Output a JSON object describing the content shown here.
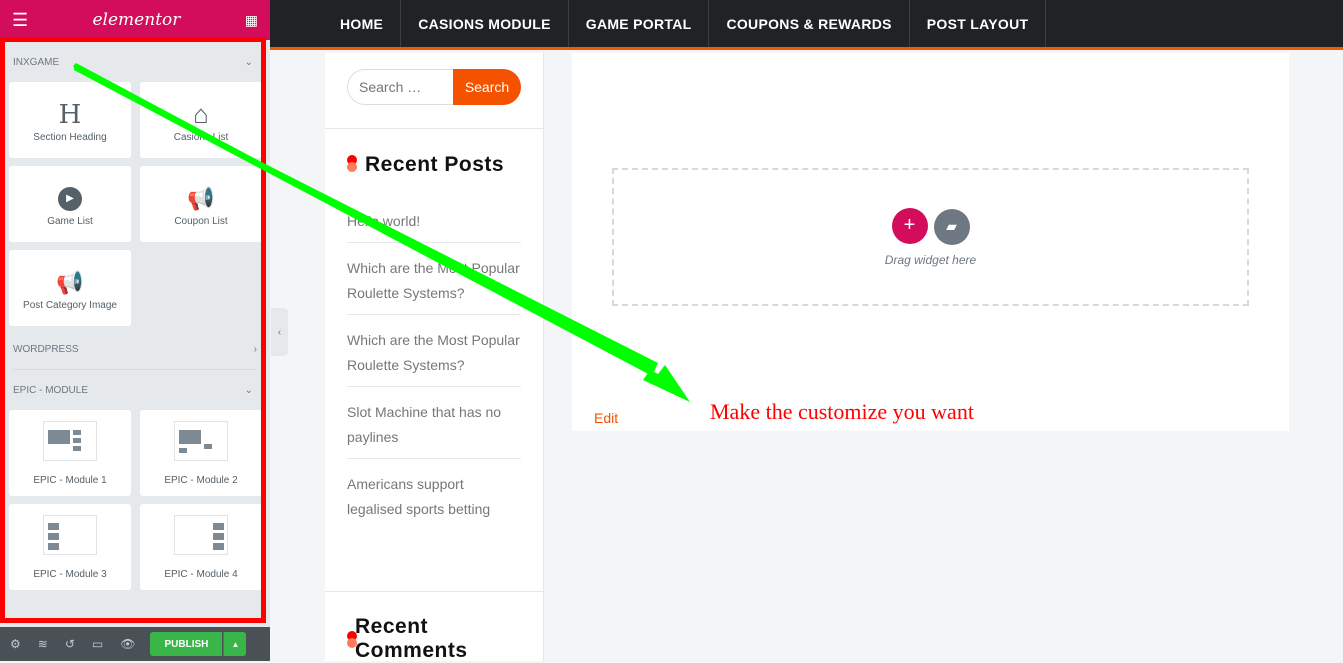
{
  "panel": {
    "logo": "elementor",
    "categories": [
      {
        "label": "INXGAME"
      },
      {
        "label": "WORDPRESS"
      },
      {
        "label": "EPIC - MODULE"
      }
    ],
    "inxgame_widgets": [
      "Section Heading",
      "Casions List",
      "Game List",
      "Coupon List",
      "Post Category Image"
    ],
    "epic_widgets": [
      "EPIC - Module 1",
      "EPIC - Module 2",
      "EPIC - Module 3",
      "EPIC - Module 4"
    ],
    "footer": {
      "publish": "PUBLISH"
    }
  },
  "nav": [
    "HOME",
    "CASIONS MODULE",
    "GAME PORTAL",
    "COUPONS & REWARDS",
    "POST LAYOUT"
  ],
  "sidebar": {
    "search_placeholder": "Search …",
    "search_button": "Search",
    "recent_posts_title": "Recent Posts",
    "posts": [
      "Hello world!",
      "Which are the Most Popular Roulette Systems?",
      "Which are the Most Popular Roulette Systems?",
      "Slot Machine that has no paylines",
      "Americans support legalised sports betting"
    ],
    "recent_comments_title": "Recent Comments"
  },
  "main": {
    "drag_hint": "Drag widget here",
    "edit": "Edit"
  },
  "annotation": "Make the customize you want",
  "colors": {
    "brand": "#d30c5c",
    "accent": "#f55200",
    "publish": "#39b54a",
    "highlight": "#ff0000",
    "arrow": "#00ff00"
  }
}
